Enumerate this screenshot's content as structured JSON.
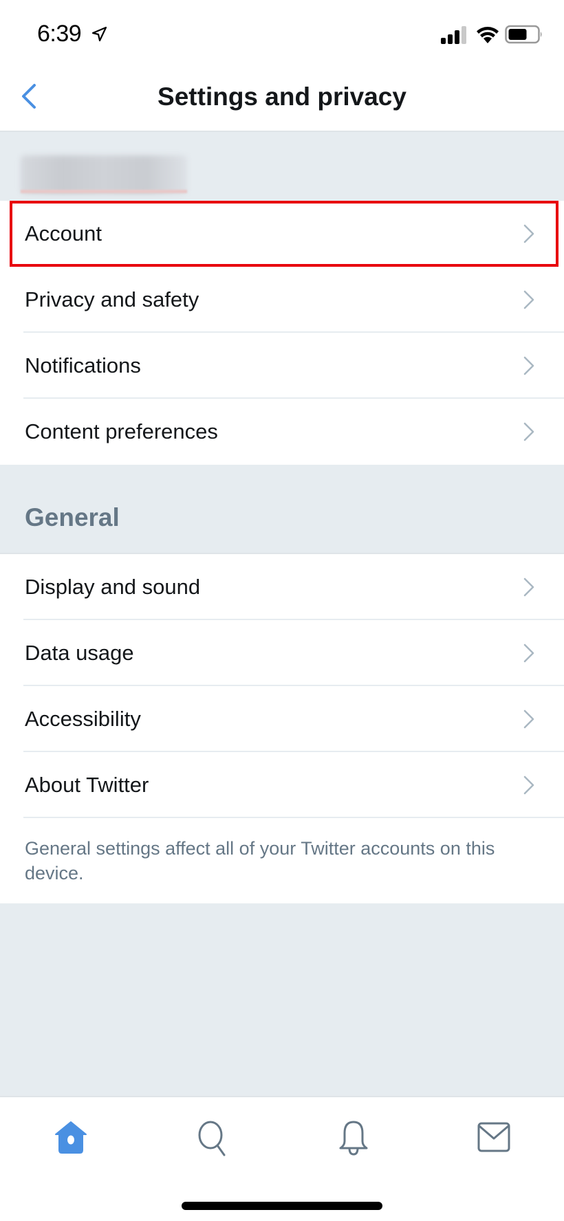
{
  "status_bar": {
    "time": "6:39",
    "location_icon": "location-arrow-icon",
    "signal_icon": "cellular-signal-icon",
    "signal_bars_active": 3,
    "signal_bars_total": 4,
    "wifi_icon": "wifi-icon",
    "battery_icon": "battery-icon",
    "battery_level": 0.6
  },
  "nav": {
    "title": "Settings and privacy",
    "back_icon": "chevron-left-icon"
  },
  "account_header": {
    "username": "(blurred)"
  },
  "account_group": {
    "items": [
      {
        "label": "Account",
        "highlighted": true
      },
      {
        "label": "Privacy and safety"
      },
      {
        "label": "Notifications"
      },
      {
        "label": "Content preferences"
      }
    ]
  },
  "general_section": {
    "title": "General",
    "items": [
      {
        "label": "Display and sound"
      },
      {
        "label": "Data usage"
      },
      {
        "label": "Accessibility"
      },
      {
        "label": "About Twitter"
      }
    ],
    "footnote": "General settings affect all of your Twitter accounts on this device."
  },
  "tab_bar": {
    "tabs": [
      {
        "name": "home",
        "icon": "home-icon",
        "active": true
      },
      {
        "name": "search",
        "icon": "search-icon"
      },
      {
        "name": "notifications",
        "icon": "bell-icon"
      },
      {
        "name": "messages",
        "icon": "mail-icon"
      }
    ]
  },
  "colors": {
    "accent": "#4a90e2",
    "highlight_box": "#e8000b",
    "text_primary": "#14171a",
    "text_secondary": "#657786",
    "chevron": "#aab8c2",
    "background": "#e6ecf0",
    "tab_inactive": "#657786"
  }
}
